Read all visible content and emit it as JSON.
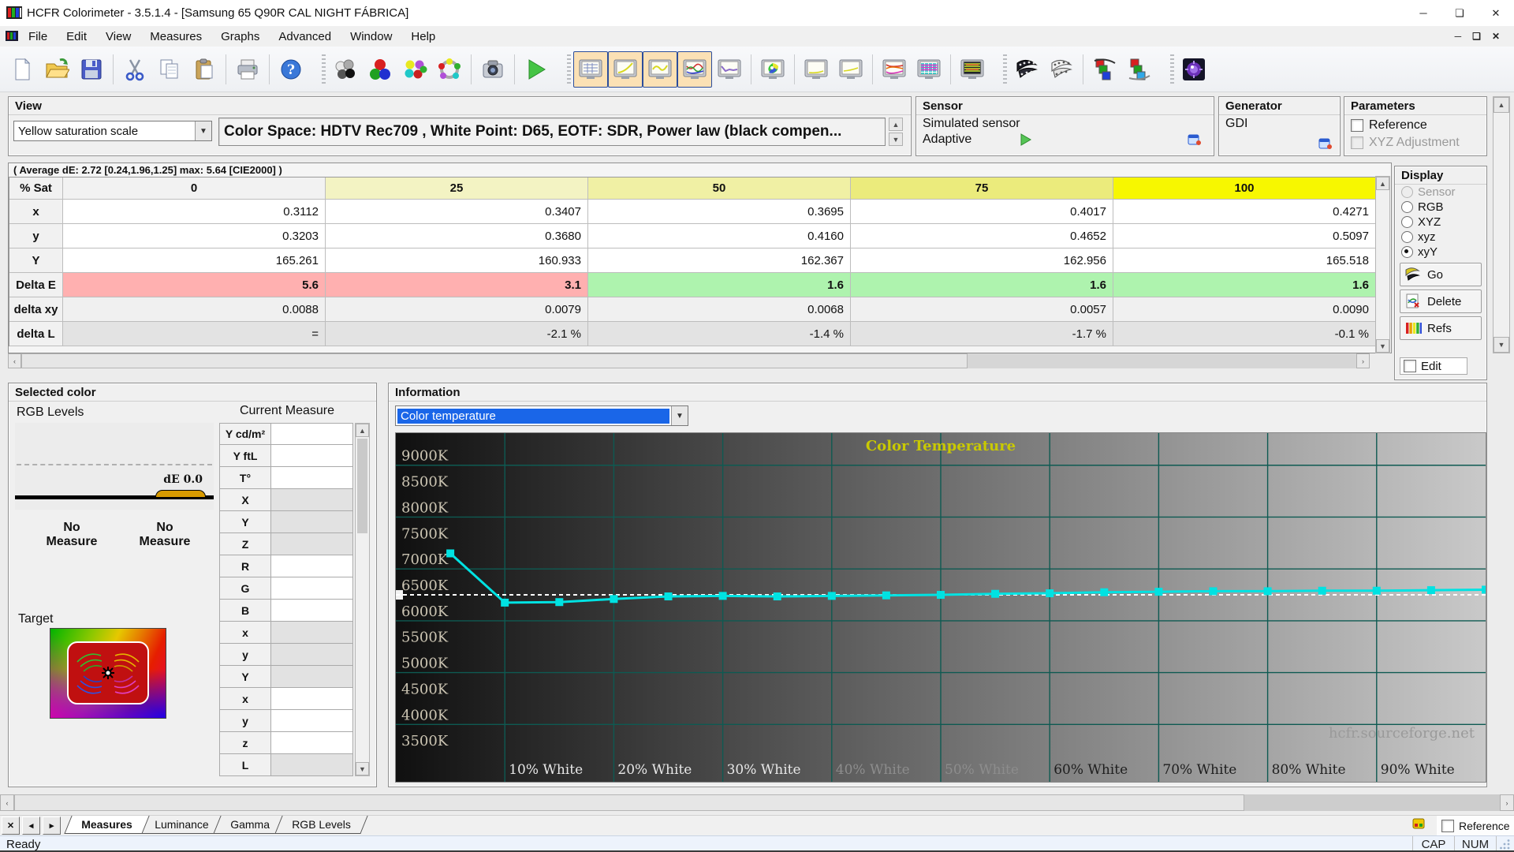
{
  "window": {
    "title": "HCFR Colorimeter - 3.5.1.4 - [Samsung 65 Q90R CAL NIGHT FÁBRICA]",
    "controls": [
      "minimize",
      "maximize",
      "close"
    ]
  },
  "menu": [
    "File",
    "Edit",
    "View",
    "Measures",
    "Graphs",
    "Advanced",
    "Window",
    "Help"
  ],
  "toolbar": {
    "items": [
      {
        "name": "new-file-icon"
      },
      {
        "name": "open-file-icon"
      },
      {
        "name": "save-file-icon"
      },
      {
        "sep": true
      },
      {
        "name": "cut-icon"
      },
      {
        "name": "copy-icon"
      },
      {
        "name": "paste-icon"
      },
      {
        "sep": true
      },
      {
        "name": "print-icon"
      },
      {
        "sep": true
      },
      {
        "name": "help-icon"
      },
      {
        "gap": true
      },
      {
        "name": "measure-grayscale-icon"
      },
      {
        "name": "measure-primaries-icon"
      },
      {
        "name": "measure-secondaries-icon"
      },
      {
        "name": "measure-saturations-icon"
      },
      {
        "sep": true
      },
      {
        "name": "capture-screen-icon"
      },
      {
        "sep": true
      },
      {
        "name": "run-measures-icon"
      },
      {
        "gap": true
      },
      {
        "name": "view-measures-table-icon",
        "active": true
      },
      {
        "name": "view-luminance-icon",
        "active": true
      },
      {
        "name": "view-gamma-icon",
        "active": true
      },
      {
        "name": "view-rgb-levels-icon",
        "active": true
      },
      {
        "name": "view-color-temperature-icon"
      },
      {
        "sep": true
      },
      {
        "name": "view-cie-chart-icon"
      },
      {
        "sep": true
      },
      {
        "name": "view-near-black-icon"
      },
      {
        "name": "view-near-white-icon"
      },
      {
        "sep": true
      },
      {
        "name": "view-color-tracking-icon"
      },
      {
        "name": "view-measures-histo-icon"
      },
      {
        "sep": true
      },
      {
        "name": "view-free-measures-icon"
      },
      {
        "gap": true
      },
      {
        "name": "film-dark-icon"
      },
      {
        "name": "film-light-icon"
      },
      {
        "sep": true
      },
      {
        "name": "film-rgb-1-icon"
      },
      {
        "name": "film-rgb-2-icon"
      },
      {
        "gap": true
      },
      {
        "name": "hcfr-settings-icon"
      }
    ]
  },
  "view_panel": {
    "title": "View",
    "dropdown_value": "Yellow saturation scale",
    "colorspace_text": "Color Space: HDTV Rec709 , White Point: D65, EOTF:  SDR, Power law (black compen..."
  },
  "sensor_panel": {
    "title": "Sensor",
    "line1": "Simulated sensor",
    "line2": "Adaptive"
  },
  "generator_panel": {
    "title": "Generator",
    "value": "GDI"
  },
  "parameters_panel": {
    "title": "Parameters",
    "checkboxes": [
      {
        "label": "Reference",
        "checked": false,
        "disabled": false
      },
      {
        "label": "XYZ Adjustment",
        "checked": false,
        "disabled": true
      }
    ]
  },
  "measure_table": {
    "average_line": "( Average dE: 2.72 [0.24,1.96,1.25] max: 5.64 [CIE2000] )",
    "corner": "% Sat",
    "columns": [
      "0",
      "25",
      "50",
      "75",
      "100"
    ],
    "column_colors": [
      "#f2f2f2",
      "#f3f3c3",
      "#f0f0a4",
      "#ebeb7c",
      "#f7f700"
    ],
    "rows": [
      {
        "label": "x",
        "values": [
          "0.3112",
          "0.3407",
          "0.3695",
          "0.4017",
          "0.4271"
        ]
      },
      {
        "label": "y",
        "values": [
          "0.3203",
          "0.3680",
          "0.4160",
          "0.4652",
          "0.5097"
        ]
      },
      {
        "label": "Y",
        "values": [
          "165.261",
          "160.933",
          "162.367",
          "162.956",
          "165.518"
        ]
      },
      {
        "label": "Delta E",
        "bold": true,
        "values": [
          "5.6",
          "3.1",
          "1.6",
          "1.6",
          "1.6"
        ],
        "cell_colors": [
          "#ffb0b0",
          "#ffb0b0",
          "#aef3ae",
          "#aef3ae",
          "#aef3ae"
        ]
      },
      {
        "label": "delta xy",
        "values": [
          "0.0088",
          "0.0079",
          "0.0068",
          "0.0057",
          "0.0090"
        ],
        "row_color": "#f0f0f0"
      },
      {
        "label": "delta L",
        "values": [
          "=",
          "-2.1 %",
          "-1.4 %",
          "-1.7 %",
          "-0.1 %"
        ],
        "row_color": "#e3e3e3"
      }
    ]
  },
  "display_panel": {
    "title": "Display",
    "radios": [
      {
        "label": "Sensor",
        "disabled": true,
        "selected": false
      },
      {
        "label": "RGB",
        "disabled": false,
        "selected": false
      },
      {
        "label": "XYZ",
        "disabled": false,
        "selected": false
      },
      {
        "label": "xyz",
        "disabled": false,
        "selected": false
      },
      {
        "label": "xyY",
        "disabled": false,
        "selected": true
      }
    ],
    "buttons": [
      {
        "label": "Go",
        "icon": "go-film-icon"
      },
      {
        "label": "Delete",
        "icon": "delete-chart-icon"
      },
      {
        "label": "Refs",
        "icon": "refs-bars-icon"
      }
    ],
    "edit_label": "Edit"
  },
  "selected_color": {
    "title": "Selected color",
    "rgb_levels_label": "RGB Levels",
    "current_measure_label": "Current Measure",
    "de_label": "dE 0.0",
    "no_measure_1a": "No",
    "no_measure_1b": "Measure",
    "no_measure_2a": "No",
    "no_measure_2b": "Measure",
    "target_label": "Target",
    "measure_rows": [
      {
        "label": "Y cd/m²",
        "gray": false
      },
      {
        "label": "Y ftL",
        "gray": false
      },
      {
        "label": "T°",
        "gray": false
      },
      {
        "label": "X",
        "gray": true
      },
      {
        "label": "Y",
        "gray": true
      },
      {
        "label": "Z",
        "gray": true
      },
      {
        "label": "R",
        "gray": false
      },
      {
        "label": "G",
        "gray": false
      },
      {
        "label": "B",
        "gray": false
      },
      {
        "label": "x",
        "gray": true
      },
      {
        "label": "y",
        "gray": true
      },
      {
        "label": "Y",
        "gray": true
      },
      {
        "label": "x",
        "gray": false
      },
      {
        "label": "y",
        "gray": false
      },
      {
        "label": "z",
        "gray": false
      },
      {
        "label": "L",
        "gray": true
      }
    ]
  },
  "information_panel": {
    "title": "Information",
    "dropdown_value": "Color temperature"
  },
  "chart_data": {
    "type": "line",
    "title": "Color Temperature",
    "title_color": "#c9c900",
    "watermark": "hcfr.sourceforge.net",
    "series": [
      {
        "name": "Measured color temperature",
        "color": "#00e2e2",
        "x_percent": [
          5,
          10,
          15,
          20,
          25,
          30,
          35,
          40,
          45,
          50,
          55,
          60,
          65,
          70,
          75,
          80,
          85,
          90,
          95,
          100
        ],
        "values_kelvin": [
          7300,
          6350,
          6360,
          6420,
          6470,
          6480,
          6470,
          6480,
          6490,
          6500,
          6520,
          6530,
          6550,
          6560,
          6570,
          6570,
          6580,
          6580,
          6590,
          6600
        ]
      }
    ],
    "reference_line_kelvin": 6500,
    "y_tick_labels": [
      "9000K",
      "8500K",
      "8000K",
      "7500K",
      "7000K",
      "6500K",
      "6000K",
      "5500K",
      "5000K",
      "4500K",
      "4000K",
      "3500K"
    ],
    "y_ticks_kelvin": [
      9000,
      8500,
      8000,
      7500,
      7000,
      6500,
      6000,
      5500,
      5000,
      4500,
      4000,
      3500
    ],
    "y_gridlines_kelvin": [
      9000,
      8000,
      7000,
      6000,
      5000,
      4000
    ],
    "ylim_kelvin": [
      2894,
      9620
    ],
    "x_gridlines_percent": [
      10,
      20,
      30,
      40,
      50,
      60,
      70,
      80,
      90
    ],
    "x_tick_labels": [
      "10% White",
      "20% White",
      "30% White",
      "40% White",
      "50% White",
      "60% White",
      "70% White",
      "80% White",
      "90% White"
    ],
    "xlim_percent": [
      0,
      100
    ],
    "background": "horizontal gradient black to light gray",
    "grid_color": "#0e5a52"
  },
  "tabbar": {
    "tabs": [
      {
        "label": "Measures",
        "active": true
      },
      {
        "label": "Luminance",
        "active": false
      },
      {
        "label": "Gamma",
        "active": false
      },
      {
        "label": "RGB Levels",
        "active": false
      }
    ],
    "reference_label": "Reference"
  },
  "statusbar": {
    "ready": "Ready",
    "cap": "CAP",
    "num": "NUM"
  }
}
